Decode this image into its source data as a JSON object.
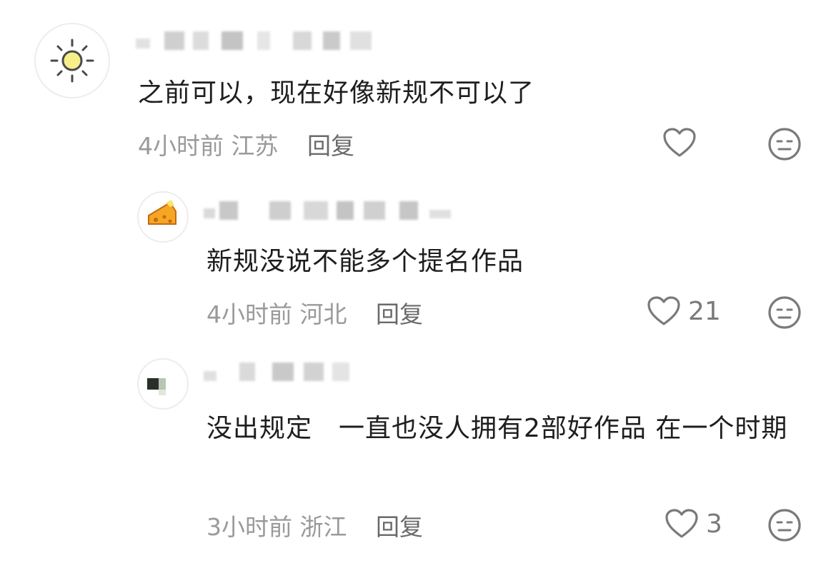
{
  "comments": [
    {
      "text": "之前可以，现在好像新规不可以了",
      "time": "4小时前",
      "location": "江苏",
      "reply_label": "回复",
      "like_count": "",
      "avatar_icon": "sun-icon"
    },
    {
      "text": "新规没说不能多个提名作品",
      "time": "4小时前",
      "location": "河北",
      "reply_label": "回复",
      "like_count": "21",
      "avatar_icon": "cheese-icon"
    },
    {
      "text": "没出规定　一直也没人拥有2部好作品 在一个时期",
      "time": "3小时前",
      "location": "浙江",
      "reply_label": "回复",
      "like_count": "3",
      "avatar_icon": "pixel-avatar"
    }
  ],
  "icons": {
    "like": "heart-outline-icon",
    "dislike": "meh-face-icon"
  },
  "colors": {
    "text": "#1e1e1e",
    "meta": "#9a9a9a",
    "reply": "#6a6a6a",
    "icon": "#7a7a7a"
  }
}
